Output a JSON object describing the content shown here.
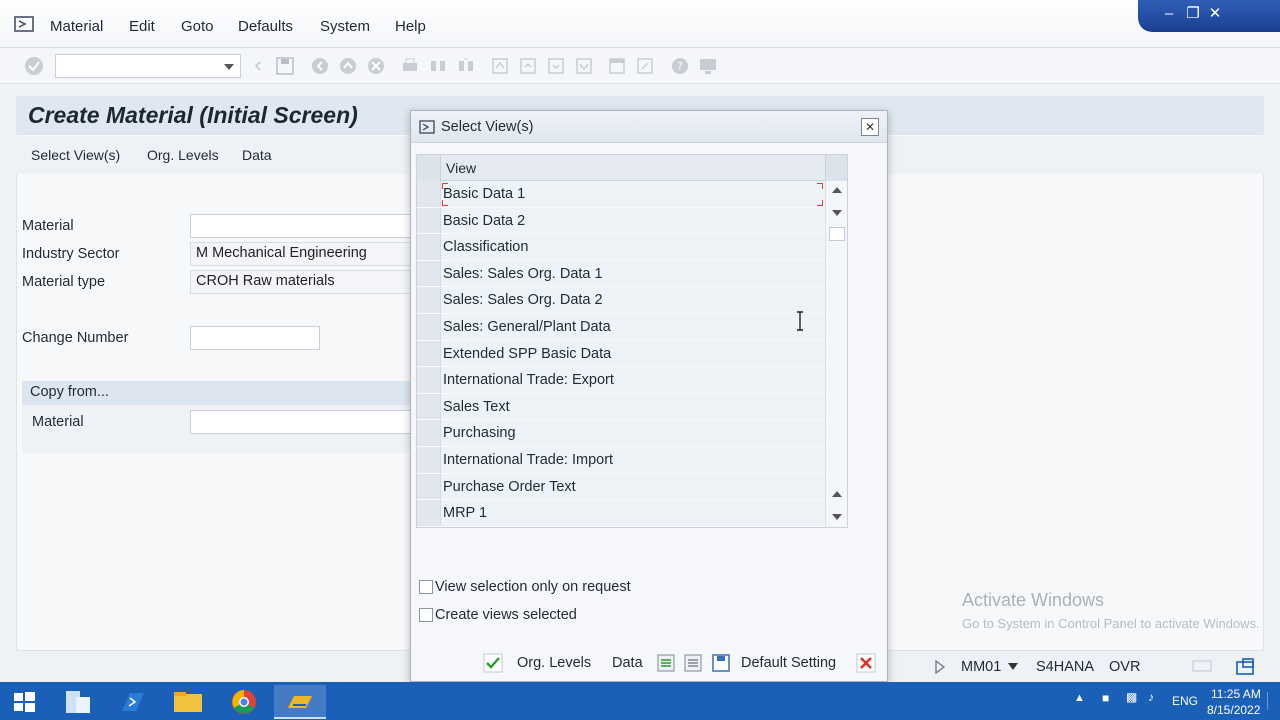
{
  "menu": {
    "items": [
      "Material",
      "Edit",
      "Goto",
      "Defaults",
      "System",
      "Help"
    ]
  },
  "page": {
    "title": "Create Material (Initial Screen)",
    "subtoolbar": [
      "Select View(s)",
      "Org. Levels",
      "Data"
    ]
  },
  "form": {
    "material_label": "Material",
    "material_value": "",
    "industry_label": "Industry Sector",
    "industry_value": "M Mechanical Engineering",
    "type_label": "Material type",
    "type_value": "CROH Raw materials",
    "change_label": "Change Number",
    "change_value": "",
    "copy_header": "Copy from...",
    "copy_material_label": "Material",
    "copy_material_value": ""
  },
  "dialog": {
    "title": "Select View(s)",
    "column_header": "View",
    "views": [
      "Basic Data 1",
      "Basic Data 2",
      "Classification",
      "Sales: Sales Org. Data 1",
      "Sales: Sales Org. Data 2",
      "Sales: General/Plant Data",
      "Extended SPP Basic Data",
      "International Trade: Export",
      "Sales Text",
      "Purchasing",
      "International Trade: Import",
      "Purchase Order Text",
      "MRP 1"
    ],
    "check_on_request": "View selection only on request",
    "check_create_selected": "Create views selected",
    "btn_org_levels": "Org. Levels",
    "btn_data": "Data",
    "btn_default_setting": "Default Setting"
  },
  "statusbar": {
    "tcode": "MM01",
    "system": "S4HANA",
    "mode": "OVR"
  },
  "watermark": {
    "line1": "Activate Windows",
    "line2": "Go to System in Control Panel to activate Windows."
  },
  "taskbar": {
    "lang": "ENG",
    "time": "11:25 AM",
    "date": "8/15/2022"
  },
  "colors": {
    "accent": "#1a5fb8",
    "ok_green": "#2e9a2e",
    "cancel_red": "#d9342b"
  }
}
